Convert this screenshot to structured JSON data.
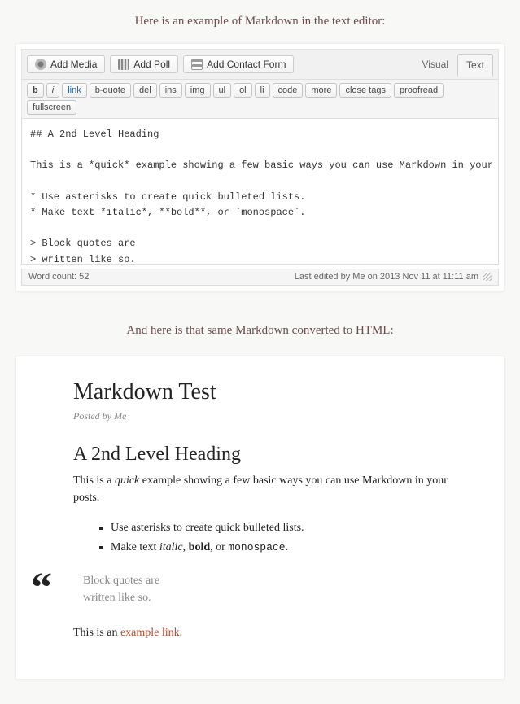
{
  "intro1": "Here is an example of Markdown in the text editor:",
  "intro2": "And here is that same Markdown converted to HTML:",
  "editor": {
    "media_buttons": {
      "add_media": "Add Media",
      "add_poll": "Add Poll",
      "add_contact_form": "Add Contact Form"
    },
    "view_tabs": {
      "visual": "Visual",
      "text": "Text"
    },
    "quicktags": {
      "b": "b",
      "i": "i",
      "link": "link",
      "b_quote": "b-quote",
      "del": "del",
      "ins": "ins",
      "img": "img",
      "ul": "ul",
      "ol": "ol",
      "li": "li",
      "code": "code",
      "more": "more",
      "close_tags": "close tags",
      "proofread": "proofread",
      "fullscreen": "fullscreen"
    },
    "content": "## A 2nd Level Heading\n\nThis is a *quick* example showing a few basic ways you can use Markdown in your posts.\n\n* Use asterisks to create quick bulleted lists.\n* Make text *italic*, **bold**, or `monospace`.\n\n> Block quotes are\n> written like so.\n\nThis is an [example link](http://en.blog.wordpress.com \"With a Title\").",
    "status": {
      "word_count_label": "Word count: 52",
      "last_edited": "Last edited by Me on 2013 Nov 11 at 11:11 am"
    }
  },
  "rendered": {
    "title": "Markdown Test",
    "meta_prefix": "Posted by ",
    "meta_author": "Me",
    "h2": "A 2nd Level Heading",
    "p1_a": "This is a ",
    "p1_quick": "quick",
    "p1_b": " example showing a few basic ways you can use Markdown in your posts.",
    "li1": "Use asterisks to create quick bulleted lists.",
    "li2_a": "Make text ",
    "li2_italic": "italic",
    "li2_b": ", ",
    "li2_bold": "bold",
    "li2_c": ", or ",
    "li2_mono": "monospace",
    "li2_d": ".",
    "bq_line1": "Block quotes are",
    "bq_line2": "written like so.",
    "p2_a": "This is an ",
    "p2_link": "example link",
    "p2_b": "."
  }
}
